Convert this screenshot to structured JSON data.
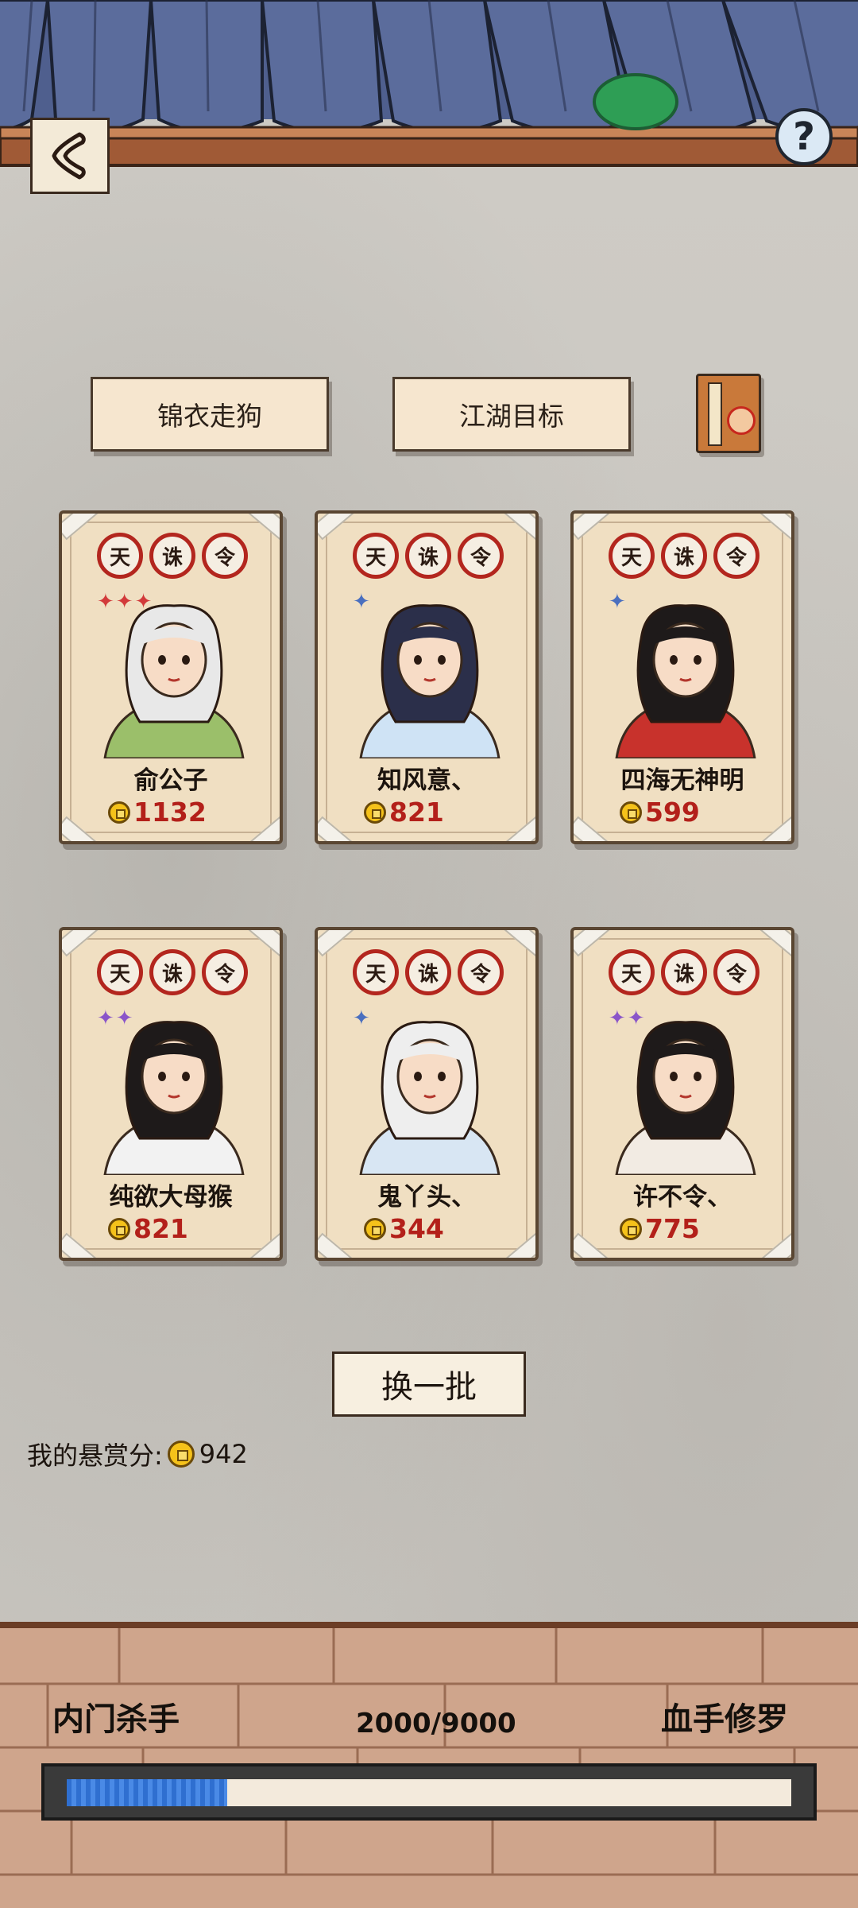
{
  "header": {
    "back_icon": "chevron-left-icon",
    "help_label": "?"
  },
  "tabs": [
    {
      "label": "锦衣走狗"
    },
    {
      "label": "江湖目标"
    }
  ],
  "book_icon": "bounty-book-icon",
  "seal_chars": [
    "天",
    "诛",
    "令"
  ],
  "targets": [
    {
      "name": "俞公子",
      "score": "1132",
      "stars": "✦✦✦",
      "star_color": "#d23a3a",
      "portrait": "white-hair-swordsman-portrait"
    },
    {
      "name": "知风意、",
      "score": "821",
      "stars": "✦",
      "star_color": "#4a6fbf",
      "portrait": "young-swordsman-portrait"
    },
    {
      "name": "四海无神明",
      "score": "599",
      "stars": "✦",
      "star_color": "#4a6fbf",
      "portrait": "red-dress-heroine-portrait"
    },
    {
      "name": "纯欲大母猴",
      "score": "821",
      "stars": "✦✦",
      "star_color": "#8a55c9",
      "portrait": "black-hair-swordsman-portrait"
    },
    {
      "name": "鬼丫头、",
      "score": "344",
      "stars": "✦",
      "star_color": "#4a6fbf",
      "portrait": "white-hair-maiden-portrait"
    },
    {
      "name": "许不令、",
      "score": "775",
      "stars": "✦✦",
      "star_color": "#8a55c9",
      "portrait": "swordswoman-portrait"
    }
  ],
  "refresh_label": "换一批",
  "my_score": {
    "label": "我的悬赏分:",
    "value": "942"
  },
  "rank": {
    "current": "内门杀手",
    "next": "血手修罗",
    "progress_text": "2000/9000",
    "progress_fraction": 0.222
  }
}
